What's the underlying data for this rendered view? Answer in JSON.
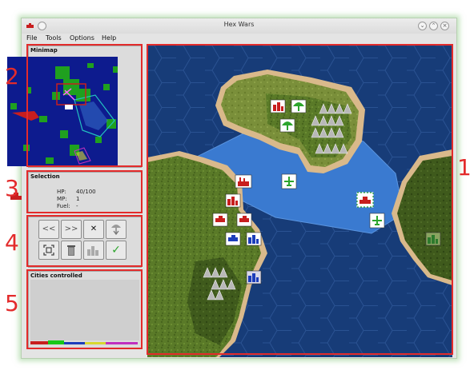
{
  "window": {
    "title": "Hex Wars"
  },
  "menu": [
    "File",
    "Tools",
    "Options",
    "Help"
  ],
  "panels": {
    "minimap_title": "Minimap",
    "selection_title": "Selection",
    "cities_title": "Cities controlled"
  },
  "selection": {
    "unit_icon": "ship-icon",
    "stats": [
      {
        "label": "HP:",
        "value": "40/100"
      },
      {
        "label": "MP:",
        "value": "1"
      },
      {
        "label": "Fuel:",
        "value": "-"
      }
    ]
  },
  "toolbar": {
    "prev_label": "<<",
    "next_label": ">>",
    "cancel_label": "✕",
    "paradrop_icon": "parachute-icon",
    "fullscreen_icon": "fit-screen-icon",
    "delete_icon": "trash-icon",
    "cities_icon": "city-icon",
    "confirm_label": "✓"
  },
  "cities_bar_colors": [
    "#c81e1e",
    "#18c818",
    "#1c3dbb",
    "#d8d830",
    "#c030c0"
  ],
  "annotations": [
    "1",
    "2",
    "3",
    "4",
    "5"
  ],
  "colors": {
    "annotation": "#e32b2b",
    "ocean_deep": "#173c78",
    "ocean_shallow": "#3a7ad0",
    "grass": "#5d7a2a",
    "coast": "#d9b98b"
  }
}
